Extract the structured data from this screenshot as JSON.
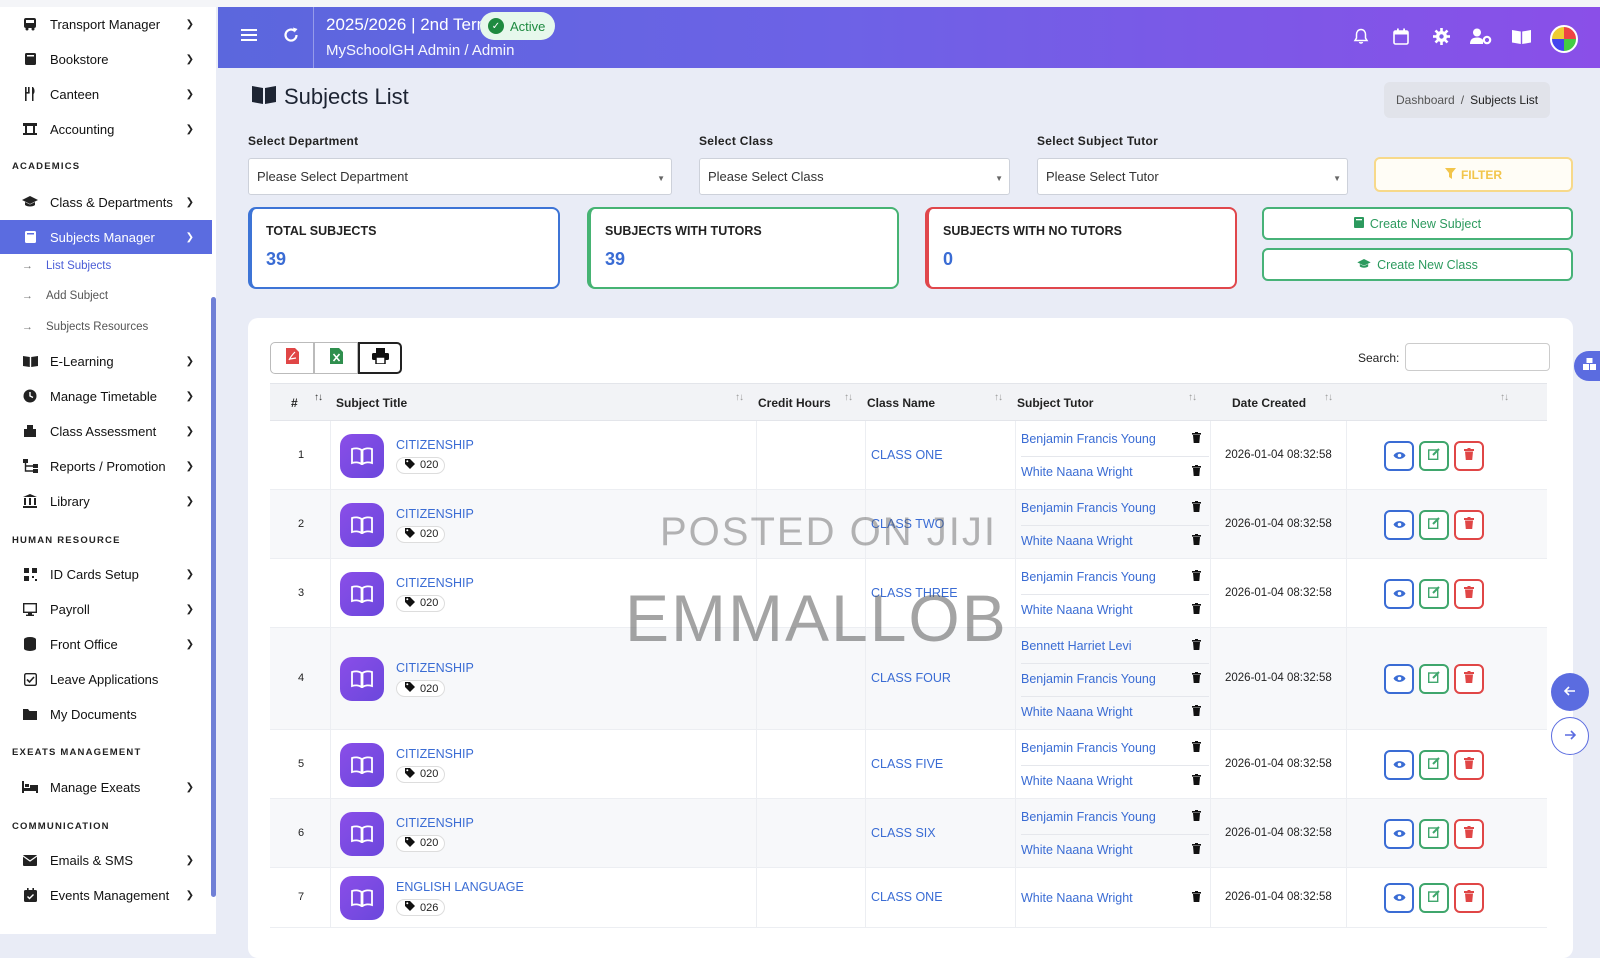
{
  "sidebar": {
    "top_items": [
      {
        "label": "Transport Manager",
        "icon": "bus-icon"
      },
      {
        "label": "Bookstore",
        "icon": "book-icon"
      },
      {
        "label": "Canteen",
        "icon": "utensils-icon"
      },
      {
        "label": "Accounting",
        "icon": "bank-icon"
      }
    ],
    "sections": {
      "academics": "ACADEMICS",
      "human_resource": "HUMAN RESOURCE",
      "exeats": "EXEATS MANAGEMENT",
      "communication": "COMMUNICATION"
    },
    "academics_items": [
      {
        "label": "Class & Departments"
      },
      {
        "label": "Subjects Manager"
      }
    ],
    "subjects_sub": [
      "List Subjects",
      "Add Subject",
      "Subjects Resources"
    ],
    "academics_more": [
      {
        "label": "E-Learning"
      },
      {
        "label": "Manage Timetable"
      },
      {
        "label": "Class Assessment"
      },
      {
        "label": "Reports / Promotion"
      },
      {
        "label": "Library"
      }
    ],
    "hr_items": [
      {
        "label": "ID Cards Setup"
      },
      {
        "label": "Payroll"
      },
      {
        "label": "Front Office"
      },
      {
        "label": "Leave Applications"
      },
      {
        "label": "My Documents"
      }
    ],
    "exeats_items": [
      {
        "label": "Manage Exeats"
      }
    ],
    "comm_items": [
      {
        "label": "Emails & SMS"
      },
      {
        "label": "Events Management"
      }
    ]
  },
  "header": {
    "term": "2025/2026 | 2nd Term",
    "status": "Active",
    "user": "MySchoolGH Admin / Admin"
  },
  "page": {
    "title": "Subjects List",
    "breadcrumb": {
      "home": "Dashboard",
      "sep": "/",
      "current": "Subjects List"
    }
  },
  "filters": {
    "department": {
      "label": "Select Department",
      "value": "Please Select Department"
    },
    "class": {
      "label": "Select Class",
      "value": "Please Select Class"
    },
    "tutor": {
      "label": "Select Subject Tutor",
      "value": "Please Select Tutor"
    },
    "filter_button": "FILTER"
  },
  "stats": {
    "total": {
      "title": "TOTAL SUBJECTS",
      "value": "39"
    },
    "with_tutors": {
      "title": "SUBJECTS WITH TUTORS",
      "value": "39"
    },
    "no_tutors": {
      "title": "SUBJECTS WITH NO TUTORS",
      "value": "0"
    }
  },
  "actions": {
    "create_subject": "Create New Subject",
    "create_class": "Create New Class"
  },
  "table": {
    "search_label": "Search:",
    "headers": {
      "num": "#",
      "title": "Subject Title",
      "credit": "Credit Hours",
      "class": "Class Name",
      "tutor": "Subject Tutor",
      "date": "Date Created"
    },
    "rows": [
      {
        "num": "1",
        "title": "CITIZENSHIP",
        "code": "020",
        "class": "CLASS ONE",
        "tutors": [
          "Benjamin Francis Young",
          "White Naana Wright"
        ],
        "date": "2026-01-04 08:32:58"
      },
      {
        "num": "2",
        "title": "CITIZENSHIP",
        "code": "020",
        "class": "CLASS TWO",
        "tutors": [
          "Benjamin Francis Young",
          "White Naana Wright"
        ],
        "date": "2026-01-04 08:32:58"
      },
      {
        "num": "3",
        "title": "CITIZENSHIP",
        "code": "020",
        "class": "CLASS THREE",
        "tutors": [
          "Benjamin Francis Young",
          "White Naana Wright"
        ],
        "date": "2026-01-04 08:32:58"
      },
      {
        "num": "4",
        "title": "CITIZENSHIP",
        "code": "020",
        "class": "CLASS FOUR",
        "tutors": [
          "Bennett Harriet Levi",
          "Benjamin Francis Young",
          "White Naana Wright"
        ],
        "date": "2026-01-04 08:32:58"
      },
      {
        "num": "5",
        "title": "CITIZENSHIP",
        "code": "020",
        "class": "CLASS FIVE",
        "tutors": [
          "Benjamin Francis Young",
          "White Naana Wright"
        ],
        "date": "2026-01-04 08:32:58"
      },
      {
        "num": "6",
        "title": "CITIZENSHIP",
        "code": "020",
        "class": "CLASS SIX",
        "tutors": [
          "Benjamin Francis Young",
          "White Naana Wright"
        ],
        "date": "2026-01-04 08:32:58"
      },
      {
        "num": "7",
        "title": "ENGLISH LANGUAGE",
        "code": "026",
        "class": "CLASS ONE",
        "tutors": [
          "White Naana Wright"
        ],
        "date": "2026-01-04 08:32:58"
      }
    ]
  },
  "watermark": {
    "line1": "POSTED ON JIJI",
    "line2": "EMMALLOB"
  },
  "colors": {
    "accent": "#5b6ce0",
    "link": "#3a6cd4",
    "success": "#46b373",
    "danger": "#e0474c",
    "warning": "#f2c54b"
  }
}
